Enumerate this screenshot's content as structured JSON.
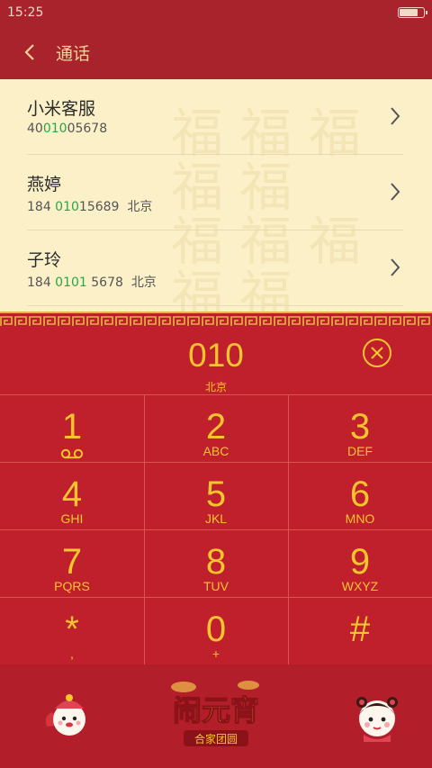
{
  "status": {
    "time": "15:25"
  },
  "header": {
    "title": "通话"
  },
  "contacts": [
    {
      "name": "小米客服",
      "num_pre": "40",
      "num_hl": "010",
      "num_post": "05678",
      "location": ""
    },
    {
      "name": "燕婷",
      "num_pre": "184 ",
      "num_hl": "010",
      "num_post": "15689",
      "location": "北京"
    },
    {
      "name": "子玲",
      "num_pre": "184 ",
      "num_hl": "0101",
      "num_post": " 5678",
      "location": "北京"
    }
  ],
  "dialer": {
    "digits": "010",
    "location": "北京",
    "keys": [
      {
        "main": "1",
        "sub": "voicemail"
      },
      {
        "main": "2",
        "sub": "ABC"
      },
      {
        "main": "3",
        "sub": "DEF"
      },
      {
        "main": "4",
        "sub": "GHI"
      },
      {
        "main": "5",
        "sub": "JKL"
      },
      {
        "main": "6",
        "sub": "MNO"
      },
      {
        "main": "7",
        "sub": "PQRS"
      },
      {
        "main": "8",
        "sub": "TUV"
      },
      {
        "main": "9",
        "sub": "WXYZ"
      },
      {
        "main": "*",
        "sub": ","
      },
      {
        "main": "0",
        "sub": "+"
      },
      {
        "main": "#",
        "sub": ""
      }
    ]
  },
  "banner": {
    "logo_text": "闹元宵",
    "logo_subtext": "合家团圆"
  },
  "colors": {
    "red": "#c01f2c",
    "gold": "#f7c52e",
    "cream": "#fbf0c8",
    "highlight": "#2aa54a"
  }
}
